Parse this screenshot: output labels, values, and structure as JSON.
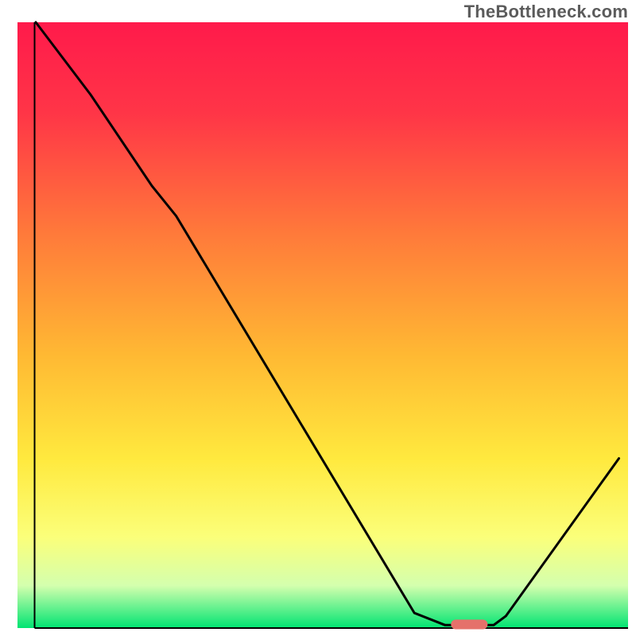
{
  "watermark": "TheBottleneck.com",
  "chart_data": {
    "type": "line",
    "title": "",
    "xlabel": "",
    "ylabel": "",
    "xlim": [
      0,
      100
    ],
    "ylim": [
      0,
      100
    ],
    "grid": false,
    "legend": false,
    "gradient_stops": [
      {
        "offset": 0.0,
        "color": "#ff1a4b"
      },
      {
        "offset": 0.15,
        "color": "#ff3547"
      },
      {
        "offset": 0.35,
        "color": "#ff7a3a"
      },
      {
        "offset": 0.55,
        "color": "#ffb933"
      },
      {
        "offset": 0.72,
        "color": "#ffe93e"
      },
      {
        "offset": 0.85,
        "color": "#fbff7a"
      },
      {
        "offset": 0.93,
        "color": "#d4ffae"
      },
      {
        "offset": 1.0,
        "color": "#00e472"
      }
    ],
    "series": [
      {
        "name": "bottleneck-curve",
        "color": "#000000",
        "x": [
          3.0,
          12.0,
          22.0,
          26.0,
          65.0,
          70.0,
          78.0,
          80.0,
          98.5
        ],
        "y": [
          100.0,
          88.0,
          73.0,
          68.0,
          2.5,
          0.5,
          0.5,
          2.0,
          28.0
        ]
      }
    ],
    "marker": {
      "name": "optimal-region",
      "shape": "rounded-rect",
      "color": "#e5716b",
      "x_center": 74.0,
      "y_center": 0.6,
      "width_pct": 6.0,
      "height_pct": 1.6
    },
    "axes": {
      "left": {
        "x": 2.8,
        "y0": 0,
        "y1": 100
      },
      "bottom": {
        "y": 0.0,
        "x0": 2.8,
        "x1": 100
      }
    }
  }
}
